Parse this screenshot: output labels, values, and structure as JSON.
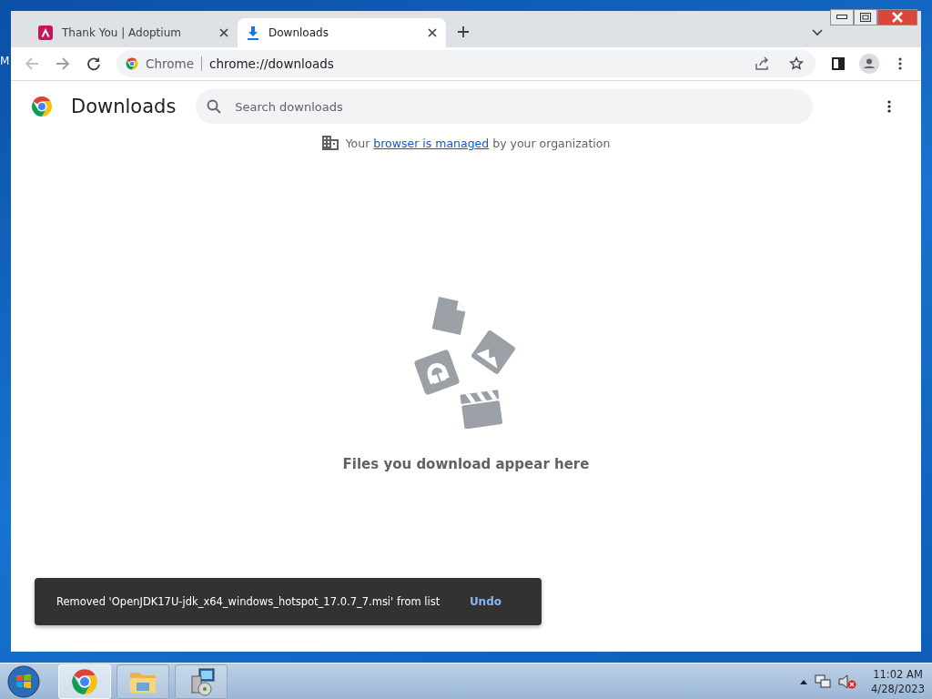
{
  "desktop": {
    "label": "M"
  },
  "tabs": [
    {
      "title": "Thank You | Adoptium",
      "kind": "site",
      "selected": false
    },
    {
      "title": "Downloads",
      "kind": "download",
      "selected": true
    }
  ],
  "toolbar": {
    "site_chip": "Chrome",
    "url": "chrome://downloads"
  },
  "page": {
    "title": "Downloads",
    "search": {
      "placeholder": "Search downloads"
    },
    "managed_notice": {
      "before": "Your ",
      "link": "browser is managed",
      "after": " by your organization"
    },
    "empty_message": "Files you download appear here"
  },
  "toast": {
    "message": "Removed 'OpenJDK17U-jdk_x64_windows_hotspot_17.0.7_7.msi' from list",
    "action": "Undo"
  },
  "taskbar": {
    "apps": [
      {
        "kind": "chrome",
        "selected": true
      },
      {
        "kind": "explorer",
        "selected": false
      },
      {
        "kind": "installer",
        "selected": false
      }
    ],
    "time": "11:02 AM",
    "date": "4/28/2023"
  }
}
